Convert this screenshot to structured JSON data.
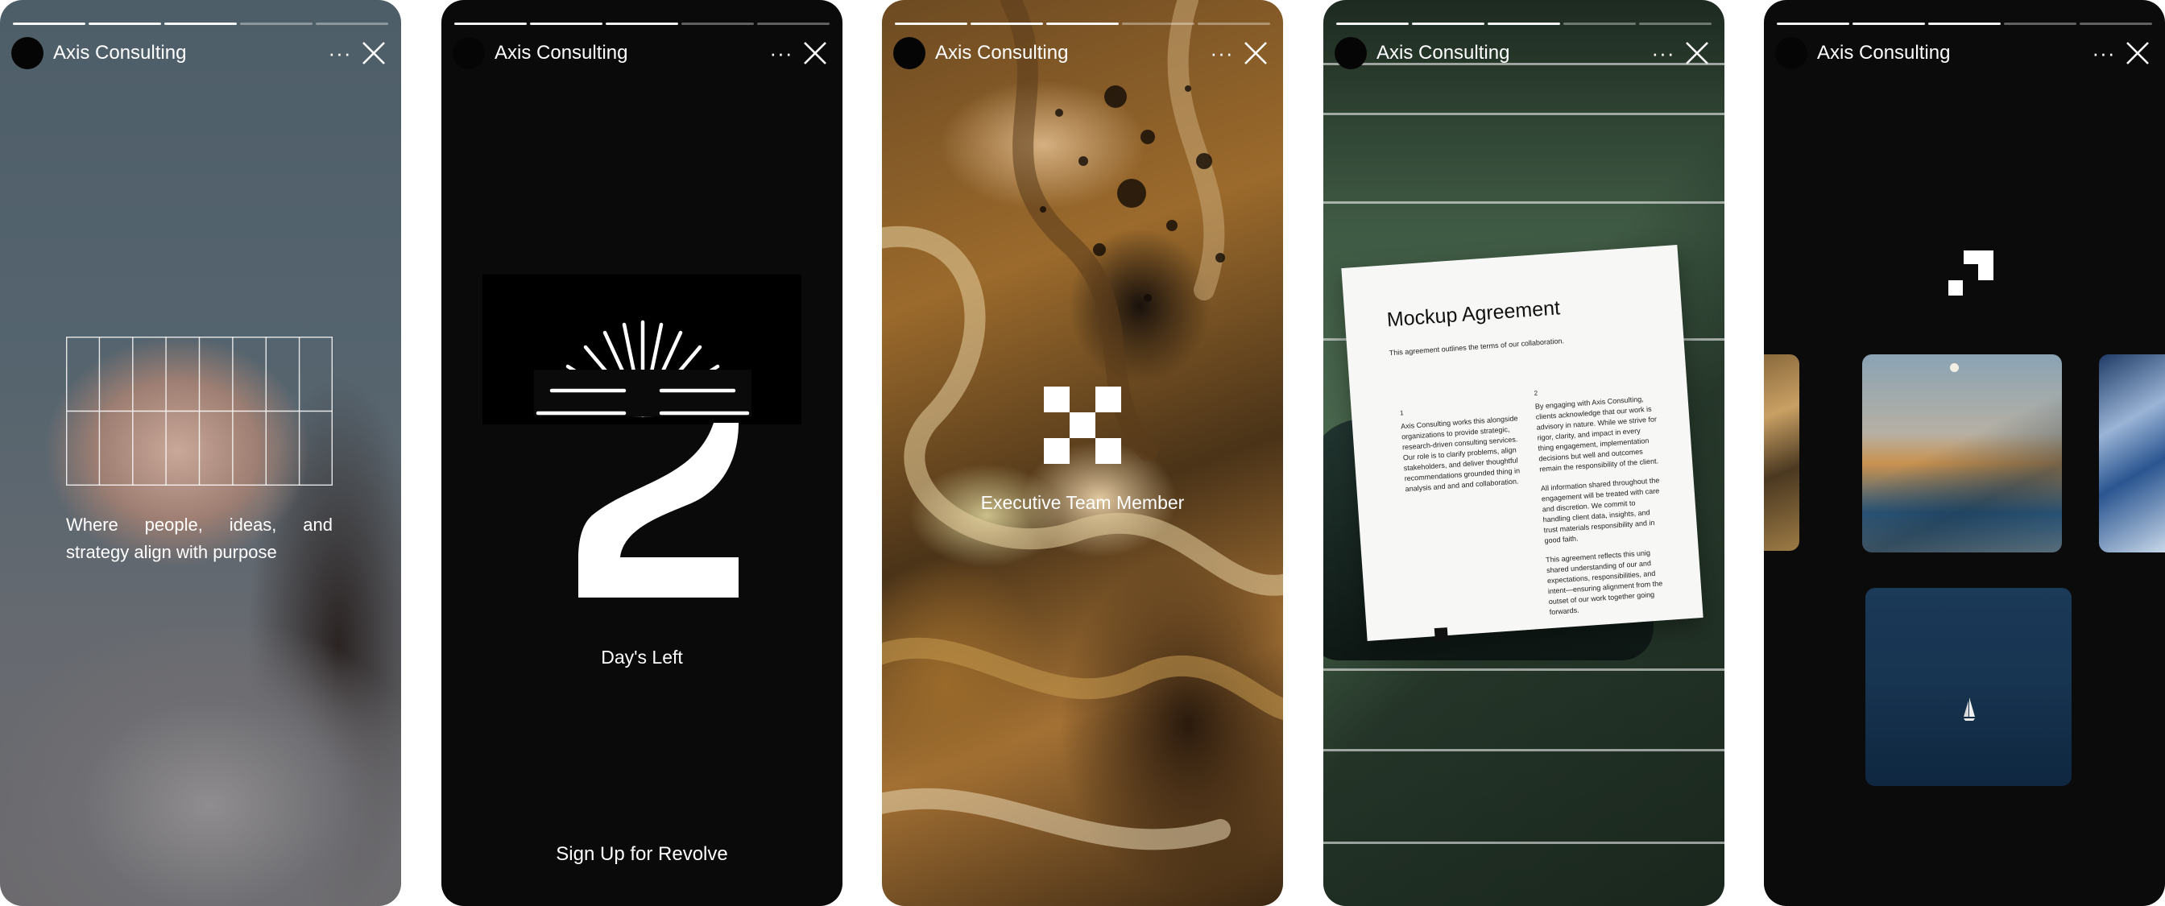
{
  "brand": {
    "name": "Axis Consulting",
    "more_glyph": "···"
  },
  "stories": [
    {
      "progress_done": 3,
      "progress_total": 5,
      "caption": "Where people, ideas, and strategy align with purpose"
    },
    {
      "progress_done": 3,
      "progress_total": 5,
      "label": "Day's Left",
      "cta": "Sign Up for Revolve"
    },
    {
      "progress_done": 3,
      "progress_total": 5,
      "label": "Executive Team Member"
    },
    {
      "progress_done": 3,
      "progress_total": 5,
      "document": {
        "title": "Mockup Agreement",
        "subtitle": "This agreement outlines the terms of our collaboration.",
        "left_number": "1",
        "left_text": "Axis Consulting works this alongside organizations to provide strategic, research-driven consulting services. Our role is to clarify problems, align stakeholders, and deliver thoughtful recommendations grounded thing in analysis and and and collaboration.",
        "right_number": "2",
        "right_paragraphs": [
          "By engaging with Axis Consulting, clients acknowledge that our work is advisory in nature. While we strive for rigor, clarity, and impact in every thing engagement, implementation decisions but well and outcomes remain the responsibility of the client.",
          "All information shared throughout the engagement will be treated with care and discretion. We commit to handling client data, insights, and trust materials responsibility and in good faith.",
          "This agreement reflects this unig shared understanding of our and expectations, responsibilities, and intent—ensuring alignment from the outset of our work together going forwards."
        ]
      }
    },
    {
      "progress_done": 3,
      "progress_total": 5
    }
  ],
  "icons": {
    "avatar": "avatar",
    "more": "more-icon",
    "close": "close-icon"
  }
}
